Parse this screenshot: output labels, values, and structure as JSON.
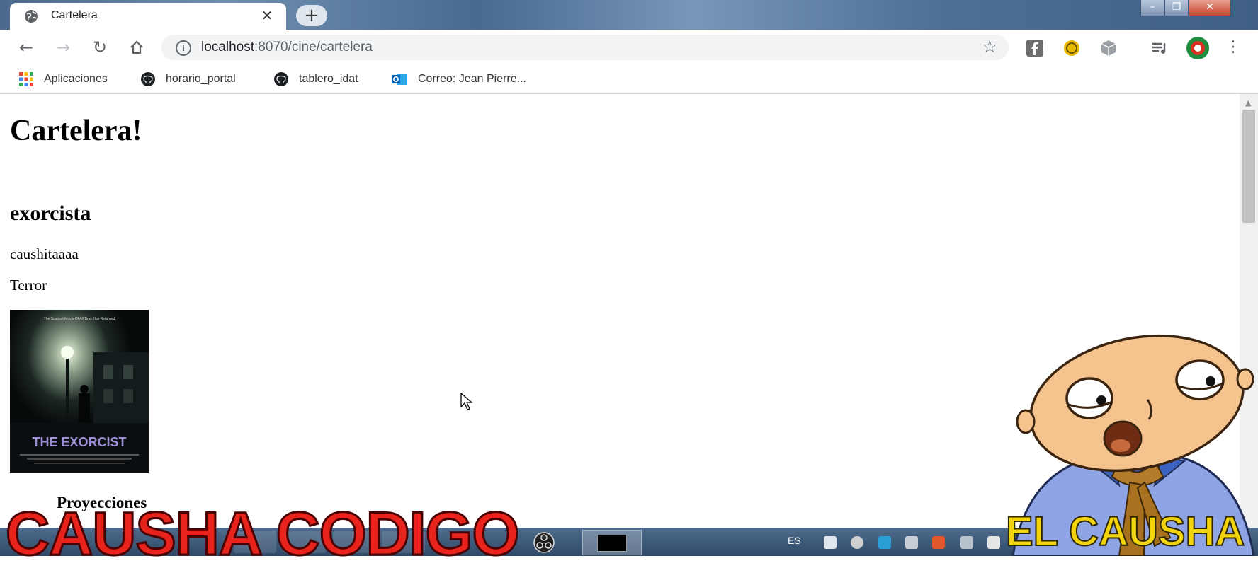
{
  "browser": {
    "tab_title": "Cartelera",
    "url_host": "localhost",
    "url_rest": ":8070/cine/cartelera",
    "bookmarks": [
      {
        "label": "Aplicaciones",
        "icon": "apps-grid-icon"
      },
      {
        "label": "horario_portal",
        "icon": "github-icon"
      },
      {
        "label": "tablero_idat",
        "icon": "github-icon"
      },
      {
        "label": "Correo: Jean Pierre...",
        "icon": "outlook-icon"
      }
    ]
  },
  "page": {
    "heading": "Cartelera!",
    "movie": {
      "title": "exorcista",
      "description": "caushitaaaa",
      "genre": "Terror",
      "poster": {
        "tagline": "The Scariest Movie Of All Time Has Returned",
        "title": "THE EXORCIST"
      }
    },
    "section": "Proyecciones"
  },
  "taskbar": {
    "language": "ES"
  },
  "overlay": {
    "watermark": "CAUSHA CODIGO",
    "mascot_label": "EL CAUSHA"
  }
}
